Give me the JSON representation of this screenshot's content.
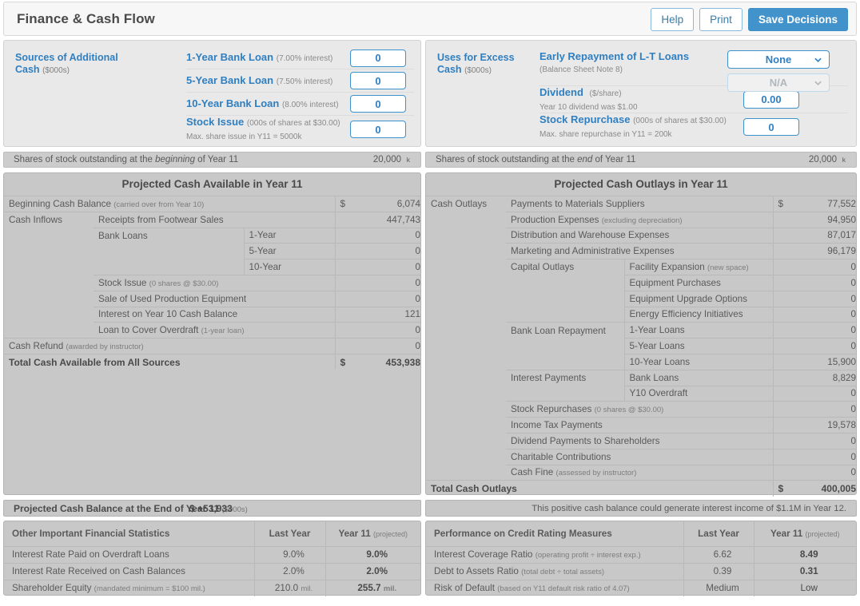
{
  "header": {
    "title": "Finance & Cash Flow",
    "buttons": [
      {
        "label": "Help",
        "name": "help-button"
      },
      {
        "label": "Print",
        "name": "print-button"
      },
      {
        "label": "Save Decisions",
        "name": "save-decisions-button"
      }
    ]
  },
  "accent_color": "#2f7fc1",
  "primary_button_color": "#4292cb",
  "sources": {
    "category": "Sources of Additional",
    "category_line2": "Cash",
    "category_unit": "($000s)",
    "rows": [
      {
        "label": "1-Year Bank Loan",
        "paren": "(7.00% interest)",
        "note": "",
        "value": "0"
      },
      {
        "label": "5-Year Bank Loan",
        "paren": "(7.50% interest)",
        "note": "",
        "value": "0"
      },
      {
        "label": "10-Year Bank Loan",
        "paren": "(8.00% interest)",
        "note": "",
        "value": "0"
      },
      {
        "label": "Stock Issue",
        "paren": "(000s of shares at $30.00)",
        "note": "Max. share issue in Y11 = 5000k",
        "value": "0"
      }
    ]
  },
  "uses": {
    "category": "Uses for Excess",
    "category_line2": "Cash",
    "category_unit": "($000s)",
    "early_repayment": {
      "label": "Early Repayment of L-T Loans",
      "note": "(Balance Sheet Note 8)",
      "select_primary": "None",
      "select_secondary": "N/A"
    },
    "dividend": {
      "label": "Dividend",
      "paren": "($/share)",
      "note": "Year 10 dividend was $1.00",
      "value": "0.00"
    },
    "stock_repurchase": {
      "label": "Stock Repurchase",
      "paren": "(000s of shares at $30.00)",
      "note": "Max. share repurchase in Y11 = 200k",
      "value": "0"
    }
  },
  "shares": {
    "beginning_label_a": "Shares of stock outstanding at the ",
    "beginning_label_em": "beginning",
    "beginning_label_b": " of Year 11",
    "beginning_value": "20,000",
    "end_label_a": "Shares of stock outstanding at the ",
    "end_label_em": "end",
    "end_label_b": " of Year 11",
    "end_value": "20,000",
    "unit": "k"
  },
  "cash_available": {
    "title": "Projected Cash Available in Year 11",
    "rows": [
      {
        "c1": "Beginning Cash Balance",
        "c1_small": "(carried over from Year 10)",
        "c2": "",
        "c3": "",
        "cur": "$",
        "value": "6,074"
      },
      {
        "c1": "Cash Inflows",
        "c2": "Receipts from Footwear Sales",
        "c3": "",
        "cur": "",
        "value": "447,743"
      },
      {
        "c1": "",
        "c2": "Bank Loans",
        "c3": "1-Year",
        "cur": "",
        "value": "0"
      },
      {
        "c1": "",
        "c2": "",
        "c3": "5-Year",
        "cur": "",
        "value": "0"
      },
      {
        "c1": "",
        "c2": "",
        "c3": "10-Year",
        "cur": "",
        "value": "0"
      },
      {
        "c1": "",
        "c2": "Stock Issue",
        "c2_small": "(0 shares @ $30.00)",
        "c3": "",
        "cur": "",
        "value": "0"
      },
      {
        "c1": "",
        "c2": "Sale of Used Production Equipment",
        "c3": "",
        "cur": "",
        "value": "0"
      },
      {
        "c1": "",
        "c2": "Interest on Year 10 Cash Balance",
        "c3": "",
        "cur": "",
        "value": "121"
      },
      {
        "c1": "",
        "c2": "Loan to Cover Overdraft",
        "c2_small": "(1-year loan)",
        "c3": "",
        "cur": "",
        "value": "0"
      },
      {
        "c1": "Cash Refund",
        "c1_small": "(awarded by instructor)",
        "c2": "",
        "c3": "",
        "cur": "",
        "value": "0"
      }
    ],
    "total_label": "Total Cash Available from All Sources",
    "total_currency": "$",
    "total_value": "453,938"
  },
  "cash_outlays": {
    "title": "Projected Cash Outlays in Year 11",
    "rows": [
      {
        "c1": "Cash Outlays",
        "c2": "Payments to Materials Suppliers",
        "c3": "",
        "cur": "$",
        "value": "77,552"
      },
      {
        "c1": "",
        "c2": "Production Expenses",
        "c2_small": "(excluding depreciation)",
        "c3": "",
        "cur": "",
        "value": "94,950"
      },
      {
        "c1": "",
        "c2": "Distribution and Warehouse Expenses",
        "c3": "",
        "cur": "",
        "value": "87,017"
      },
      {
        "c1": "",
        "c2": "Marketing and Administrative Expenses",
        "c3": "",
        "cur": "",
        "value": "96,179"
      },
      {
        "c1": "",
        "c2": "Capital Outlays",
        "c3": "Facility Expansion",
        "c3_small": "(new space)",
        "cur": "",
        "value": "0"
      },
      {
        "c1": "",
        "c2": "",
        "c3": "Equipment Purchases",
        "cur": "",
        "value": "0"
      },
      {
        "c1": "",
        "c2": "",
        "c3": "Equipment Upgrade Options",
        "cur": "",
        "value": "0"
      },
      {
        "c1": "",
        "c2": "",
        "c3": "Energy Efficiency Initiatives",
        "cur": "",
        "value": "0"
      },
      {
        "c1": "",
        "c2": "Bank Loan Repayment",
        "c3": "1-Year Loans",
        "cur": "",
        "value": "0"
      },
      {
        "c1": "",
        "c2": "",
        "c3": "5-Year Loans",
        "cur": "",
        "value": "0"
      },
      {
        "c1": "",
        "c2": "",
        "c3": "10-Year Loans",
        "cur": "",
        "value": "15,900"
      },
      {
        "c1": "",
        "c2": "Interest Payments",
        "c3": "Bank Loans",
        "cur": "",
        "value": "8,829"
      },
      {
        "c1": "",
        "c2": "",
        "c3": "Y10 Overdraft",
        "cur": "",
        "value": "0"
      },
      {
        "c1": "",
        "c2": "Stock Repurchases",
        "c2_small": "(0 shares @ $30.00)",
        "c3": "",
        "cur": "",
        "value": "0"
      },
      {
        "c1": "",
        "c2": "Income Tax Payments",
        "c3": "",
        "cur": "",
        "value": "19,578"
      },
      {
        "c1": "",
        "c2": "Dividend Payments to Shareholders",
        "c3": "",
        "cur": "",
        "value": "0"
      },
      {
        "c1": "",
        "c2": "Charitable Contributions",
        "c3": "",
        "cur": "",
        "value": "0"
      },
      {
        "c1": "",
        "c2": "Cash Fine",
        "c2_small": "(assessed by instructor)",
        "c3": "",
        "cur": "",
        "value": "0"
      }
    ],
    "total_label": "Total Cash Outlays",
    "total_currency": "$",
    "total_value": "400,005"
  },
  "balance_bar": {
    "label": "Projected Cash Balance at the End of Year 11",
    "unit": "($000s)",
    "currency": "$",
    "amount": "+53,933",
    "note": "This positive cash balance could generate interest income of $1.1M in Year 12."
  },
  "other_stats": {
    "title": "Other Important Financial Statistics",
    "col_last_year": "Last Year",
    "col_projected": "Year 11",
    "col_projected_note": "(projected)",
    "rows": [
      {
        "label": "Interest Rate Paid on Overdraft Loans",
        "small": "",
        "last": "9.0%",
        "proj": "9.0%",
        "unit": ""
      },
      {
        "label": "Interest Rate Received on Cash Balances",
        "small": "",
        "last": "2.0%",
        "proj": "2.0%",
        "unit": ""
      },
      {
        "label": "Shareholder Equity",
        "small": "(mandated minimum = $100 mil.)",
        "last": "210.0",
        "proj": "255.7",
        "unit": "mil."
      }
    ]
  },
  "credit_stats": {
    "title": "Performance on Credit Rating Measures",
    "col_last_year": "Last Year",
    "col_projected": "Year 11",
    "col_projected_note": "(projected)",
    "rows": [
      {
        "label": "Interest Coverage Ratio",
        "small": "(operating profit ÷ interest exp.)",
        "last": "6.62",
        "proj": "8.49",
        "unit": ""
      },
      {
        "label": "Debt to Assets Ratio",
        "small": "(total debt ÷ total assets)",
        "last": "0.39",
        "proj": "0.31",
        "unit": ""
      },
      {
        "label": "Risk of Default",
        "small": "(based on Y11 default risk ratio of 4.07)",
        "last": "Medium",
        "proj": "Low",
        "unit": ""
      }
    ]
  }
}
